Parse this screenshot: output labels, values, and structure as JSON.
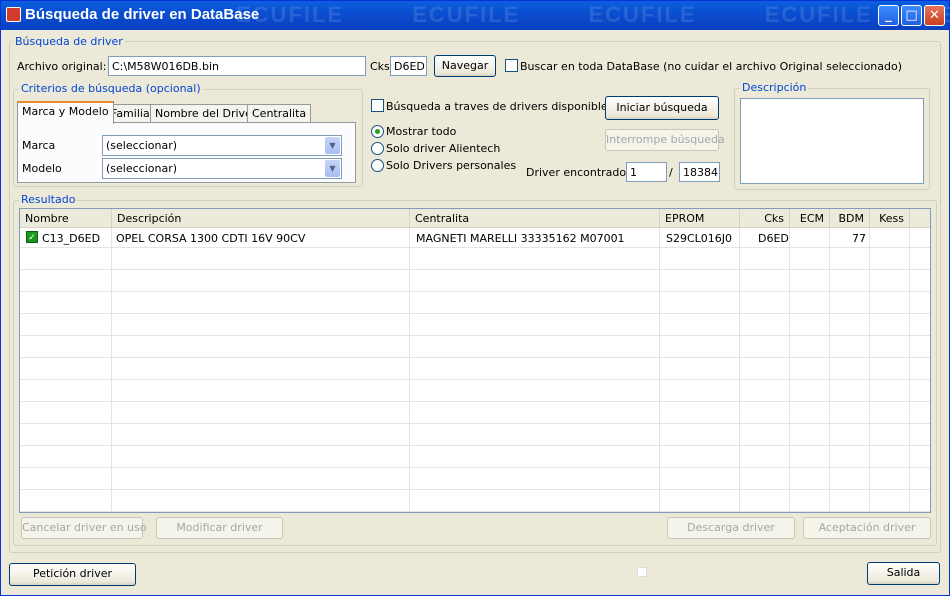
{
  "window": {
    "title": "Búsqueda de  driver en DataBase",
    "watermark": "ECUFILE ECUFILE ECUFILE ECUFILE ECUFILE ECUFILE",
    "minimize": "_",
    "maximize": "□",
    "close": "✕"
  },
  "search": {
    "group_label": "Búsqueda de driver",
    "archivo_label": "Archivo original:",
    "archivo_value": "C:\\M58W016DB.bin",
    "cks_label": "Cks",
    "cks_value": "D6ED",
    "navegar_label": "Navegar",
    "buscar_todo_label": "Buscar en toda DataBase (no cuidar el archivo Original seleccionado)"
  },
  "criteria": {
    "group_label": "Criterios de búsqueda (opcional)",
    "tabs": [
      "Marca y Modelo",
      "Familia",
      "Nombre del Driver",
      "Centralita"
    ],
    "marca_label": "Marca",
    "marca_value": "(seleccionar)",
    "modelo_label": "Modelo",
    "modelo_value": "(seleccionar)"
  },
  "options": {
    "busqueda_traves_label": "Búsqueda a traves de drivers disponibles",
    "radio_mostrar": "Mostrar todo",
    "radio_alientech": "Solo driver Alientech",
    "radio_personales": "Solo Drivers personales",
    "iniciar_label": "Iniciar búsqueda",
    "interrumpir_label": "Interrompe búsqueda",
    "driver_encontrado_label": "Driver encontrado:",
    "driver_current": "1",
    "driver_sep": "/",
    "driver_total": "18384"
  },
  "description": {
    "group_label": "Descripción"
  },
  "result": {
    "group_label": "Resultado",
    "columns": [
      "Nombre",
      "Descripción",
      "Centralita",
      "EPROM",
      "Cks",
      "ECM",
      "BDM",
      "Kess"
    ],
    "rows": [
      {
        "nombre": "C13_D6ED",
        "descripcion": "OPEL CORSA 1300 CDTI 16V  90CV",
        "centralita": "MAGNETI MARELLI 33335162 M07001",
        "eprom": "S29CL016J0",
        "cks": "D6ED",
        "ecm": "",
        "bdm": "77",
        "kess": ""
      }
    ]
  },
  "actions": {
    "cancelar_label": "Cancelar driver en uso",
    "modificar_label": "Modificar driver",
    "descarga_label": "Descarga driver",
    "aceptacion_label": "Aceptación driver",
    "peticion_label": "Petición driver",
    "salida_label": "Salida"
  }
}
